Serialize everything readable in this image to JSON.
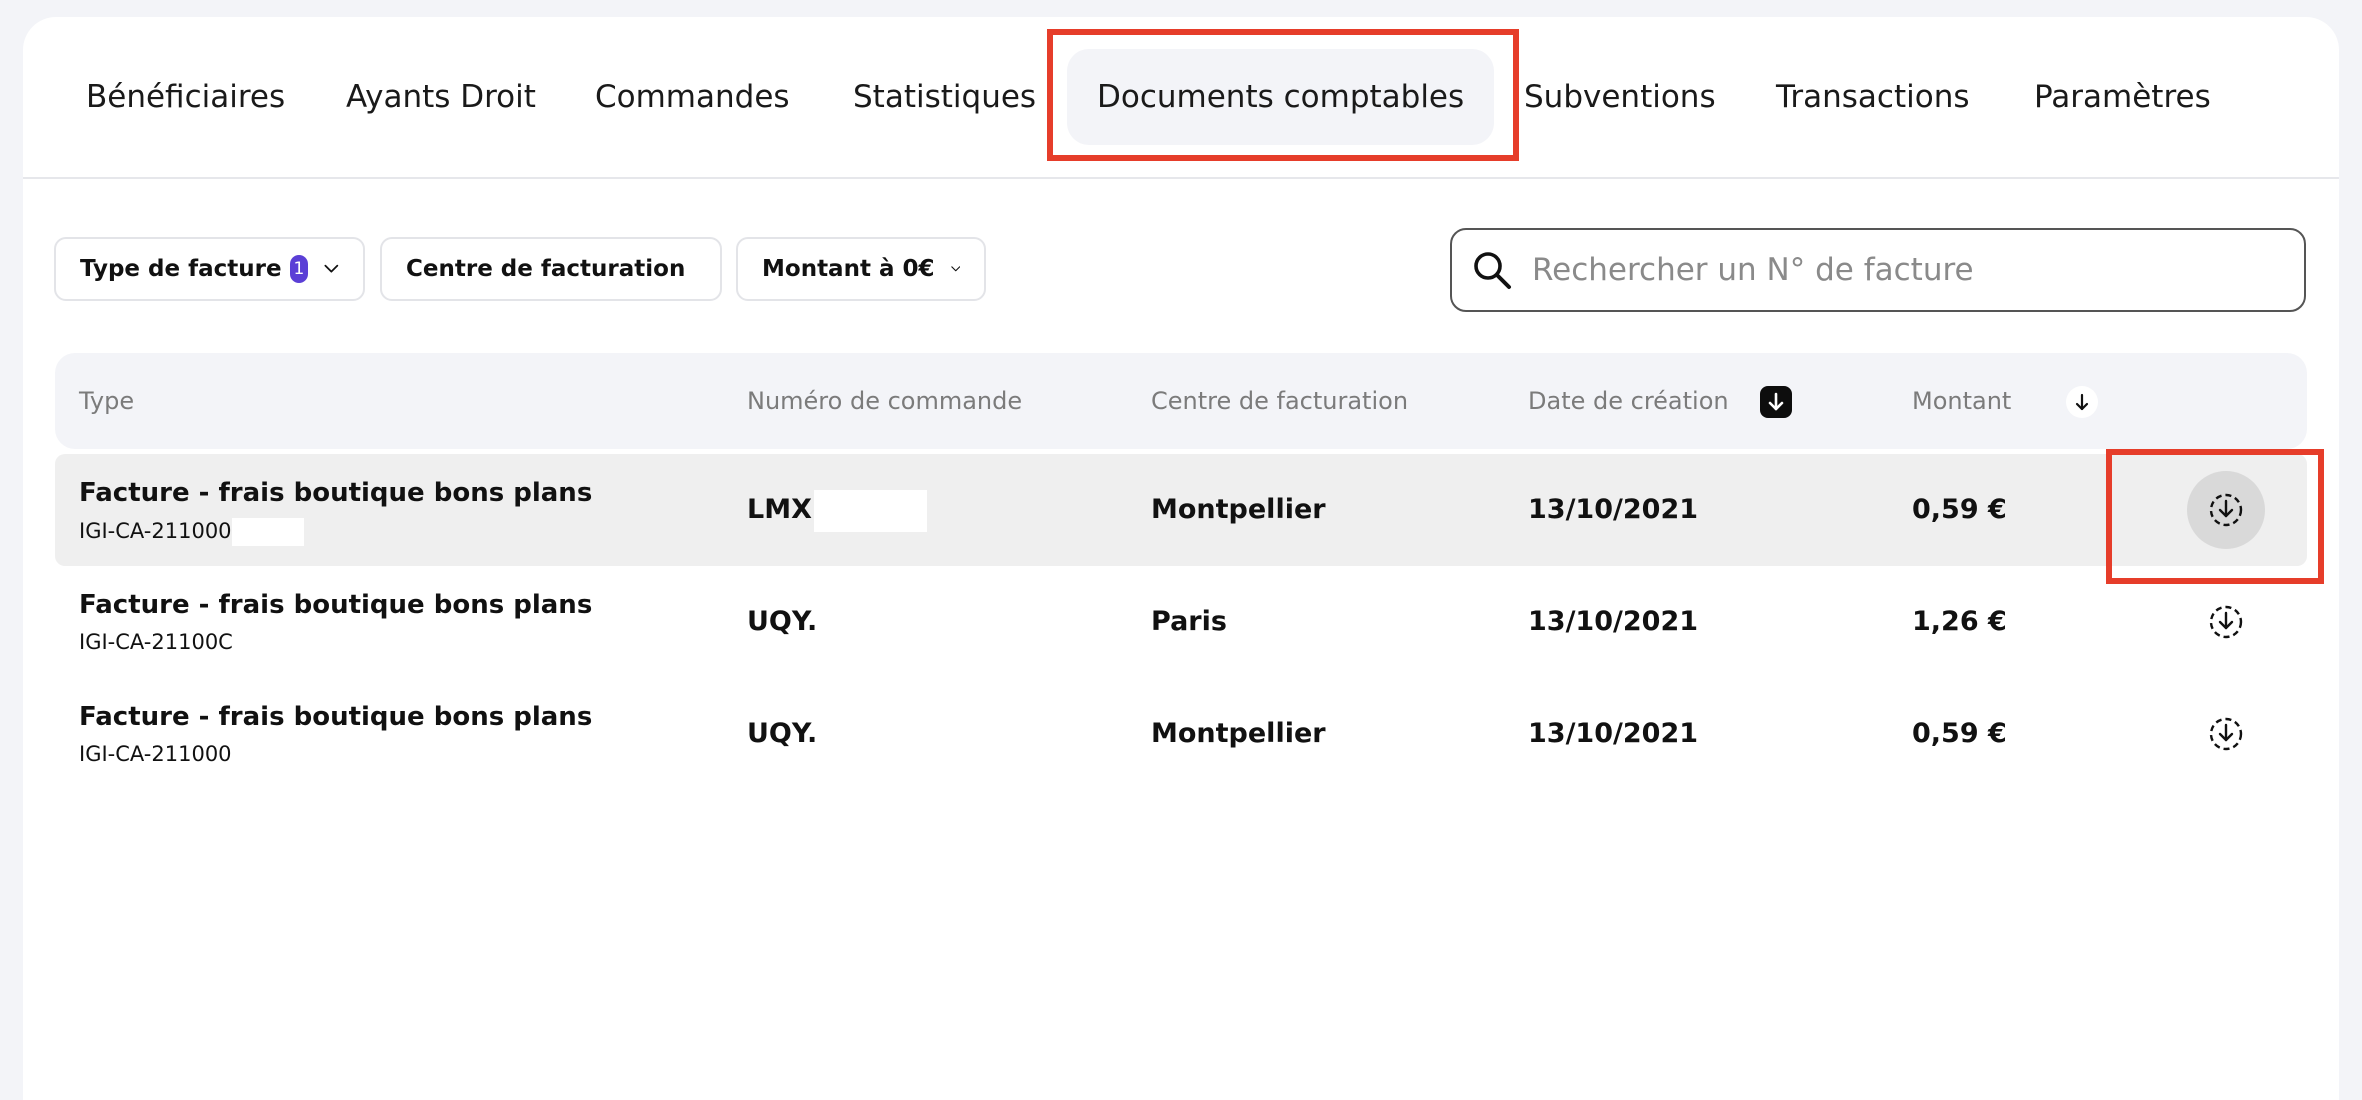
{
  "tabs": [
    {
      "label": "Bénéficiaires"
    },
    {
      "label": "Ayants Droit"
    },
    {
      "label": "Commandes"
    },
    {
      "label": "Statistiques"
    },
    {
      "label": "Documents comptables",
      "active": true
    },
    {
      "label": "Subventions"
    },
    {
      "label": "Transactions"
    },
    {
      "label": "Paramètres"
    }
  ],
  "filters": {
    "invoice_type": {
      "label": "Type de facture",
      "count": "1"
    },
    "billing_center": {
      "label": "Centre de facturation"
    },
    "amount": {
      "label": "Montant à 0€"
    }
  },
  "search": {
    "placeholder": "Rechercher un N° de facture",
    "icon": "search-icon"
  },
  "table": {
    "headers": {
      "type": "Type",
      "order_number": "Numéro de commande",
      "billing_center": "Centre de facturation",
      "created_date": "Date de création",
      "amount": "Montant"
    },
    "rows": [
      {
        "type": "Facture - frais boutique bons plans",
        "reference": "IGI-CA-211000",
        "order_number": "LMX",
        "billing_center": "Montpellier",
        "created_date": "13/10/2021",
        "amount": "0,59 €"
      },
      {
        "type": "Facture - frais boutique bons plans",
        "reference": "IGI-CA-21100C",
        "order_number": "UQY.",
        "billing_center": "Paris",
        "created_date": "13/10/2021",
        "amount": "1,26 €"
      },
      {
        "type": "Facture - frais boutique bons plans",
        "reference": "IGI-CA-211000",
        "order_number": "UQY.",
        "billing_center": "Montpellier",
        "created_date": "13/10/2021",
        "amount": "0,59 €"
      }
    ]
  },
  "colors": {
    "highlight": "#e63d2a",
    "badge": "#5b3fd6",
    "background": "#f3f4f8"
  }
}
